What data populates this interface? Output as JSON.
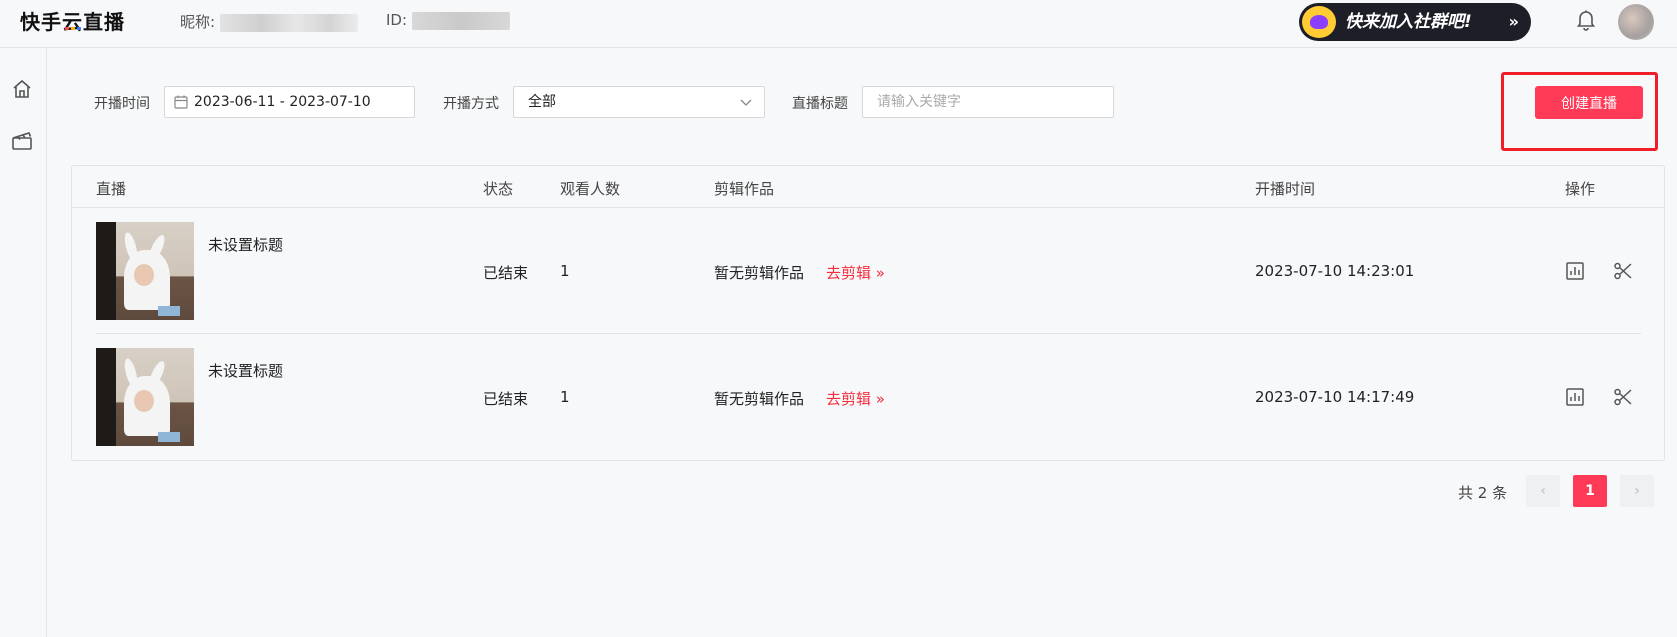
{
  "header": {
    "logo_part1": "快手",
    "logo_cloud": "云",
    "logo_part2": "直播",
    "nickname_label": "昵称:",
    "id_label": "ID:",
    "promo_text": "快来加入社群吧!",
    "promo_arrow": "»"
  },
  "filters": {
    "date_label": "开播时间",
    "date_value": "2023-06-11  - 2023-07-10",
    "mode_label": "开播方式",
    "mode_value": "全部",
    "title_label": "直播标题",
    "title_placeholder": "请输入关键字",
    "create_button": "创建直播"
  },
  "table": {
    "headers": {
      "live": "直播",
      "status": "状态",
      "viewers": "观看人数",
      "clips": "剪辑作品",
      "start_time": "开播时间",
      "ops": "操作"
    },
    "rows": [
      {
        "title": "未设置标题",
        "status": "已结束",
        "viewers": "1",
        "clips": "暂无剪辑作品",
        "go_edit": "去剪辑 »",
        "start_time": "2023-07-10 14:23:01"
      },
      {
        "title": "未设置标题",
        "status": "已结束",
        "viewers": "1",
        "clips": "暂无剪辑作品",
        "go_edit": "去剪辑 »",
        "start_time": "2023-07-10 14:17:49"
      }
    ]
  },
  "pagination": {
    "total": "共 2 条",
    "prev": "‹",
    "current": "1",
    "next": "›"
  },
  "colors": {
    "accent": "#fe3a57",
    "highlight_border": "#f01e28",
    "link_red": "#f52d3d"
  }
}
